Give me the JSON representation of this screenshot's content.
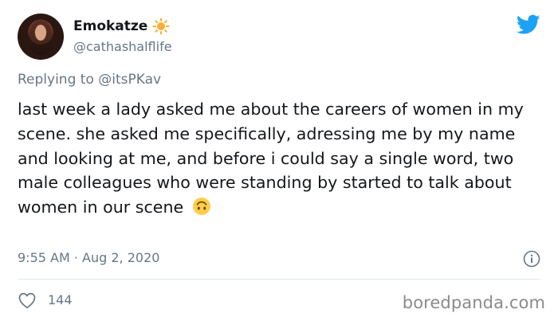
{
  "author": {
    "display_name": "Emokatze",
    "name_emoji": "sun-icon",
    "handle": "@cathashalflife"
  },
  "reply": {
    "prefix": "Replying to",
    "mention": "@itsPKav"
  },
  "tweet": {
    "text": "last week a lady asked me about the careers of women in my scene. she asked me specifically, adressing me by my name and looking at me, and before i could say a single word, two male colleagues who were standing by started to talk about women in our scene",
    "trailing_emoji": "upside-down-face-emoji"
  },
  "meta": {
    "timestamp": "9:55 AM · Aug 2, 2020"
  },
  "engagement": {
    "likes": "144"
  },
  "watermark": "boredpanda.com",
  "colors": {
    "twitter_blue": "#1da1f2",
    "muted_text": "#657786",
    "primary_text": "#14171a",
    "sun_yellow": "#ffac33"
  }
}
